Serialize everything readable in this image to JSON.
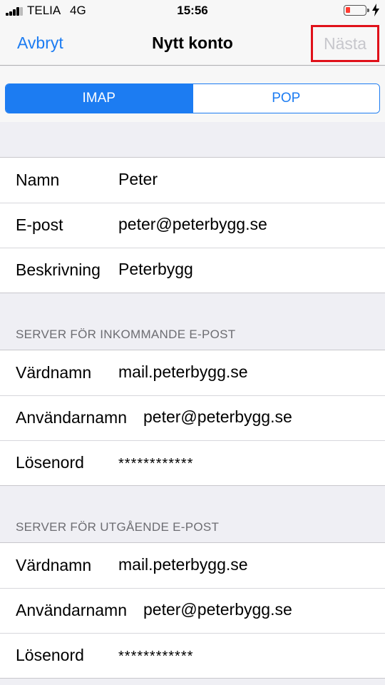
{
  "status": {
    "carrier": "TELIA",
    "network": "4G",
    "time": "15:56",
    "battery_level": 0.15,
    "battery_color": "#ff3b30"
  },
  "nav": {
    "cancel": "Avbryt",
    "title": "Nytt konto",
    "next": "Nästa"
  },
  "segment": {
    "options": [
      "IMAP",
      "POP"
    ],
    "selected": "IMAP"
  },
  "account": {
    "name_label": "Namn",
    "name_value": "Peter",
    "email_label": "E-post",
    "email_value": "peter@peterbygg.se",
    "description_label": "Beskrivning",
    "description_value": "Peterbygg"
  },
  "incoming": {
    "header": "SERVER FÖR INKOMMANDE E-POST",
    "host_label": "Värdnamn",
    "host_value": "mail.peterbygg.se",
    "user_label": "Användarnamn",
    "user_value": "peter@peterbygg.se",
    "password_label": "Lösenord",
    "password_value": "************"
  },
  "outgoing": {
    "header": "SERVER FÖR UTGÅENDE E-POST",
    "host_label": "Värdnamn",
    "host_value": "mail.peterbygg.se",
    "user_label": "Användarnamn",
    "user_value": "peter@peterbygg.se",
    "password_label": "Lösenord",
    "password_value": "************"
  },
  "colors": {
    "accent": "#1c7cf2",
    "highlight_box": "#e0111a"
  }
}
